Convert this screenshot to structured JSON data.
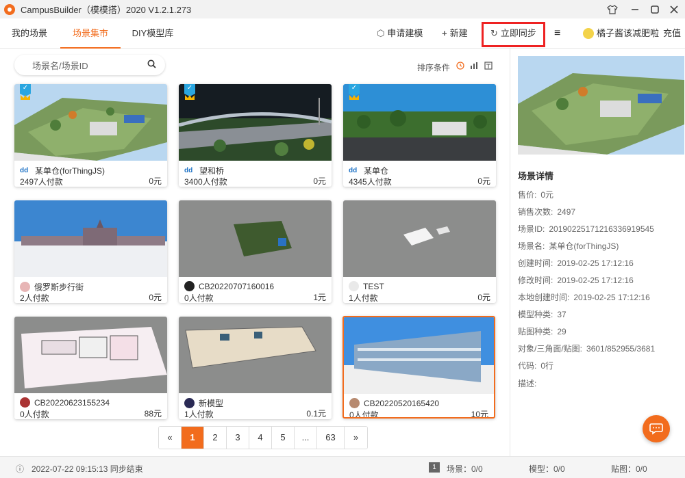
{
  "titlebar": {
    "title": "CampusBuilder（模模搭）2020  V1.2.1.273"
  },
  "nav": {
    "tabs": [
      {
        "label": "我的场景"
      },
      {
        "label": "场景集市"
      },
      {
        "label": "DIY模型库"
      }
    ],
    "actions": {
      "apply": "申请建模",
      "new": "新建",
      "sync": "立即同步",
      "user": "橘子酱该减肥啦",
      "recharge": "充值"
    }
  },
  "search": {
    "placeholder": "场景名/场景ID"
  },
  "sort": {
    "label": "排序条件"
  },
  "cards": [
    {
      "name": "某单仓(forThingJS)",
      "buyers": "2497人付款",
      "price": "0元"
    },
    {
      "name": "望和桥",
      "buyers": "3400人付款",
      "price": "0元"
    },
    {
      "name": "某单仓",
      "buyers": "4345人付款",
      "price": "0元"
    },
    {
      "name": "俄罗斯步行街",
      "buyers": "2人付款",
      "price": "0元"
    },
    {
      "name": "CB20220707160016",
      "buyers": "0人付款",
      "price": "1元"
    },
    {
      "name": "TEST",
      "buyers": "1人付款",
      "price": "0元"
    },
    {
      "name": "CB20220623155234",
      "buyers": "0人付款",
      "price": "88元"
    },
    {
      "name": "新模型",
      "buyers": "1人付款",
      "price": "0.1元"
    },
    {
      "name": "CB20220520165420",
      "buyers": "0人付款",
      "price": "10元"
    }
  ],
  "pager": {
    "prev": "«",
    "pages": [
      "1",
      "2",
      "3",
      "4",
      "5",
      "...",
      "63"
    ],
    "next": "»"
  },
  "details": {
    "heading": "场景详情",
    "rows": [
      {
        "label": "售价:",
        "value": "0元"
      },
      {
        "label": "销售次数:",
        "value": "2497"
      },
      {
        "label": "场景ID:",
        "value": "20190225171216336919545"
      },
      {
        "label": "场景名:",
        "value": "某单仓(forThingJS)"
      },
      {
        "label": "创建时间:",
        "value": "2019-02-25 17:12:16"
      },
      {
        "label": "修改时间:",
        "value": "2019-02-25 17:12:16"
      },
      {
        "label": "本地创建时间:",
        "value": "2019-02-25 17:12:16"
      },
      {
        "label": "模型种类:",
        "value": "37"
      },
      {
        "label": "贴图种类:",
        "value": "29"
      },
      {
        "label": "对象/三角面/贴图:",
        "value": "3601/852955/3681"
      },
      {
        "label": "代码:",
        "value": "0行"
      },
      {
        "label": "描述:",
        "value": ""
      }
    ]
  },
  "status": {
    "time": "2022-07-22 09:15:13 同步结束",
    "badge": "1",
    "scene": "场景：0/0",
    "model": "模型：0/0",
    "texture": "贴图：0/0"
  },
  "colors": {
    "accent": "#f26c1d",
    "highlight": "#e22222"
  }
}
